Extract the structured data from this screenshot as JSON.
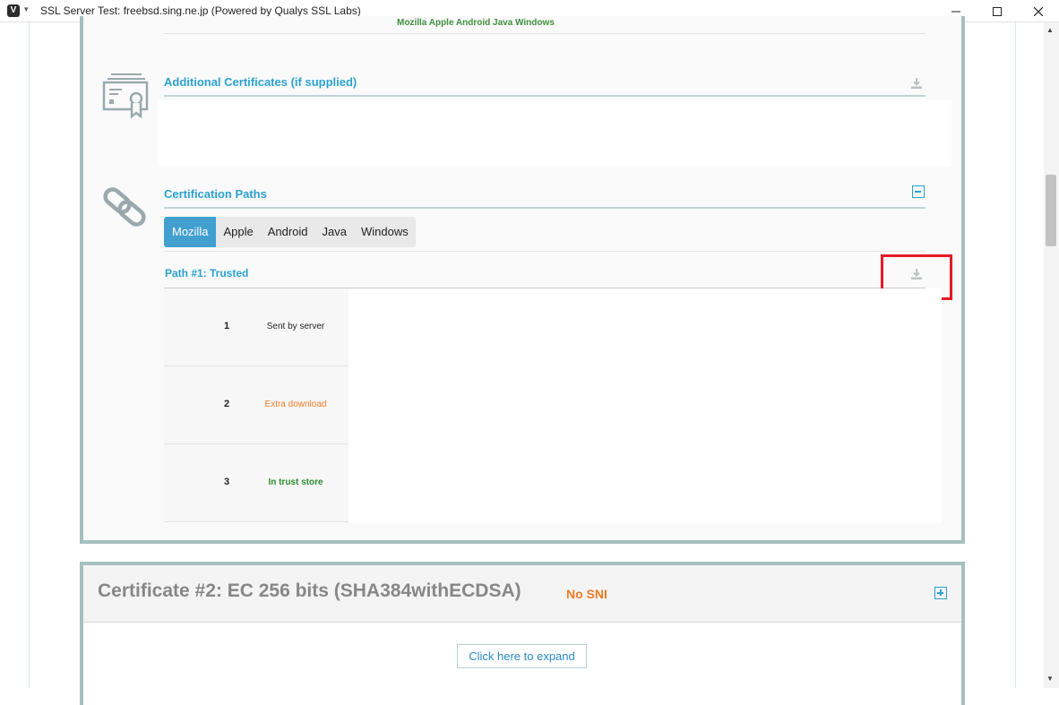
{
  "window": {
    "title": "SSL Server Test: freebsd.sing.ne.jp (Powered by Qualys SSL Labs)",
    "app_icon": "V",
    "menu_caret": "▾"
  },
  "header_faded": "Mozilla Apple Android Java Windows",
  "additional_certificates": {
    "title": "Additional Certificates (if supplied)"
  },
  "certification_paths": {
    "title": "Certification Paths",
    "tabs": [
      "Mozilla",
      "Apple",
      "Android",
      "Java",
      "Windows"
    ],
    "active_tab": "Mozilla",
    "path_title": "Path #1: Trusted",
    "rows": [
      {
        "num": "1",
        "text": "Sent by server",
        "color": "#222222"
      },
      {
        "num": "2",
        "text": "Extra download",
        "color": "#f07b25"
      },
      {
        "num": "3",
        "text": "In trust store",
        "color": "#2e8b2e"
      }
    ]
  },
  "certificate2": {
    "title": "Certificate #2: EC 256 bits (SHA384withECDSA)",
    "badge": "No SNI",
    "expand_label": "Click here to expand"
  },
  "colors": {
    "accent": "#2aa1d1",
    "panel_border": "#a6bfbf",
    "highlight": "#e51b24"
  }
}
